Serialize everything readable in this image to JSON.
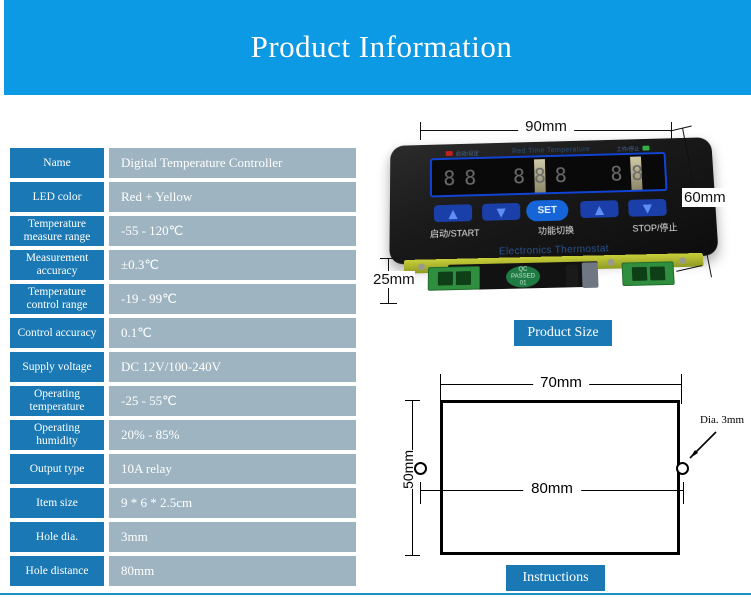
{
  "header": {
    "title": "Product Information",
    "background_color": "#0c9ae5",
    "text_color": "#ffffff"
  },
  "colors": {
    "banner_blue": "#0c9ae5",
    "label_blue": "#1a79b4",
    "value_steel": "#9eb4c1",
    "badge_blue": "#1a79b4",
    "rule_blue": "#1a8fc9",
    "drawing_black": "#000000"
  },
  "spec_table": {
    "rows": [
      {
        "label": "Name",
        "value": "Digital Temperature Controller"
      },
      {
        "label": "LED color",
        "value": "Red + Yellow"
      },
      {
        "label": "Temperature measure range",
        "value": "-55 - 120℃"
      },
      {
        "label": "Measurement accuracy",
        "value": "±0.3℃"
      },
      {
        "label": "Temperature control range",
        "value": "-19 - 99℃"
      },
      {
        "label": "Control accuracy",
        "value": "0.1℃"
      },
      {
        "label": "Supply voltage",
        "value": "DC 12V/100-240V"
      },
      {
        "label": "Operating temperature",
        "value": "-25 - 55℃"
      },
      {
        "label": "Operating humidity",
        "value": "20% - 85%"
      },
      {
        "label": "Output type",
        "value": "10A relay"
      },
      {
        "label": "Item size",
        "value": "9 * 6 * 2.5cm"
      },
      {
        "label": "Hole dia.",
        "value": "3mm"
      },
      {
        "label": "Hole distance",
        "value": "80mm"
      }
    ]
  },
  "product_size": {
    "badge": "Product Size",
    "dimensions": {
      "width": "90mm",
      "height": "60mm",
      "depth": "25mm"
    },
    "device": {
      "brand_top": "Red Time Temperature",
      "brand_bottom": "Electronics Thermostat",
      "indicator_left_label": "启动/设定",
      "indicator_right_label": "工作/停止",
      "display_digits_left": [
        "8",
        "8"
      ],
      "display_digits_mid": [
        "8",
        "8",
        "8"
      ],
      "display_digits_right": [
        "8",
        "8"
      ],
      "set_button": "SET",
      "button_labels": [
        "启动/START",
        "功能切换",
        "STOP/停止"
      ],
      "qc_sticker": [
        "QC",
        "PASSED",
        "01"
      ]
    }
  },
  "instructions": {
    "badge": "Instructions",
    "cutout": {
      "width": "70mm",
      "height": "50mm",
      "hole_distance": "80mm",
      "hole_dia_note": "Dia. 3mm"
    }
  }
}
